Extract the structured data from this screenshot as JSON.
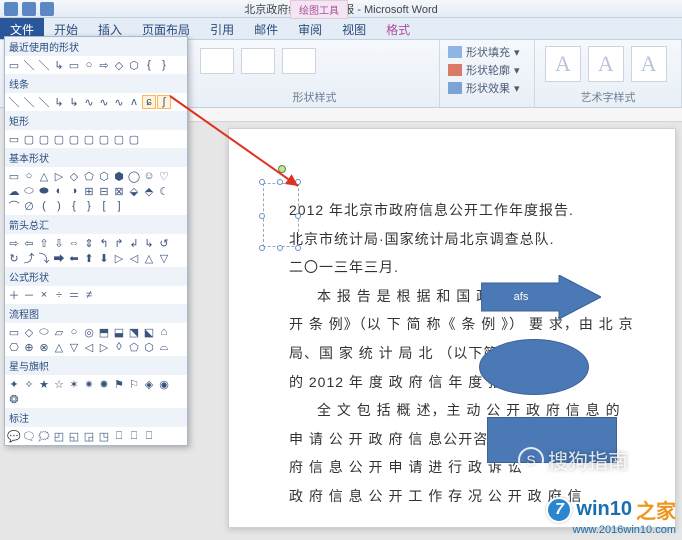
{
  "window": {
    "title": "北京政府统计工作年报 - Microsoft Word"
  },
  "context_tab_header": "绘图工具",
  "tabs": {
    "file": "文件",
    "items": [
      "开始",
      "插入",
      "页面布局",
      "引用",
      "邮件",
      "审阅",
      "视图"
    ],
    "context": "格式"
  },
  "ribbon": {
    "shape_styles_label": "形状样式",
    "wordart_styles_label": "艺术字样式",
    "fill": "形状填充",
    "outline": "形状轮廓",
    "effects": "形状效果",
    "letterA": "A"
  },
  "shapes_panel": {
    "recent": "最近使用的形状",
    "lines": "线条",
    "rects": "矩形",
    "basic": "基本形状",
    "block_arrows": "箭头总汇",
    "equation": "公式形状",
    "flowchart": "流程图",
    "stars": "星与旗帜",
    "callouts": "标注"
  },
  "document": {
    "p1": "2012 年北京市政府信息公开工作年度报告.",
    "p2": "北京市统计局·国家统计局北京调查总队.",
    "p3": "二〇一三年三月.",
    "p4": "本 报 告 是 根 据                     和 国 政 府",
    "p5": "开 条 例》（以 下 简 称《 条 例 》） 要 求，由 北 京",
    "p6": "局、国 家 统 计 局 北              （以下简称统计局",
    "p7": "的 2012 年 度 政 府 信               年 度 报 告 。",
    "p8": "全 文 包 括 概 述，主 动 公 开 政 府 信 息 的",
    "p9": "申 请 公 开 政 府 信                   息公开咨询情",
    "p10": "府 信 息 公 开 申 请                   进 行 政 诉 讼",
    "p11": "政 府 信 息 公 开 工 作 存 况             公 开 政 府 信",
    "arrow_text": "afs"
  },
  "watermarks": {
    "sogou": "搜狗指南",
    "s_letter": "S",
    "win10_brand": "win10",
    "win10_zhi": "之家",
    "win10_logo": "7",
    "win10_url": "www.2016win10.com"
  }
}
